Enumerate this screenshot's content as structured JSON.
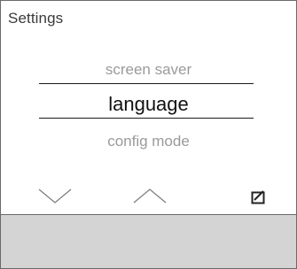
{
  "header": {
    "title": "Settings"
  },
  "menu": {
    "previous_item": "screen saver",
    "selected_item": "language",
    "next_item": "config mode"
  },
  "softkeys": {
    "down_icon": "chevron-down-icon",
    "up_icon": "chevron-up-icon",
    "confirm_icon": "edit-confirm-icon"
  },
  "colors": {
    "text_dim": "#9a9a9a",
    "text_selected": "#111111",
    "lower_panel": "#d4d4d4",
    "border": "#6a6a6a"
  }
}
